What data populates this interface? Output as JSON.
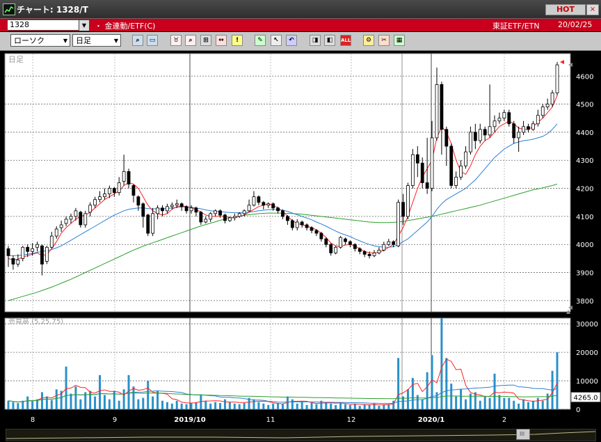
{
  "window": {
    "title": "チャート: 1328/T",
    "hot_label": "HOT",
    "close_glyph": "×"
  },
  "info": {
    "code": "1328",
    "name": "・ 金連動/ETF(C)",
    "market": "東証ETF/ETN",
    "date": "20/02/25"
  },
  "toolbar": {
    "chart_type": "ローソク",
    "period": "日足",
    "buttons": [
      "zoom-icon",
      "window-icon",
      "bull-icon",
      "search-date-icon",
      "grid-icon",
      "crosshair-icon",
      "alert-icon",
      "draw-icon",
      "cursor-icon",
      "undo-icon",
      "zoom-out-icon",
      "zoom-in-icon",
      "all-icon",
      "settings-icon",
      "tools-icon",
      "color-icon"
    ],
    "all_label": "ALL"
  },
  "price_panel": {
    "label": "日足",
    "ticks": [
      "4600",
      "4500",
      "4400",
      "4300",
      "4200",
      "4100",
      "4000",
      "3900",
      "3800"
    ]
  },
  "volume_panel": {
    "label": "売買高 (5,25,75)",
    "ticks": [
      "30000",
      "20000",
      "10000",
      "0"
    ],
    "last_value": "4265.0"
  },
  "x_axis": {
    "labels": [
      "8",
      "9",
      "2019/10",
      "11",
      "12",
      "2020/1",
      "2"
    ]
  },
  "colors": {
    "up": "#ffffff",
    "down": "#000000",
    "ma_short": "#ff2020",
    "ma_mid": "#2a7fd6",
    "ma_long": "#2aa02a",
    "volume": "#2a90c8",
    "grid": "#666666",
    "marker": "#ff2020"
  },
  "chart_data": {
    "type": "candlestick",
    "x_labels": [
      "8",
      "9",
      "2019/10",
      "11",
      "12",
      "2020/1",
      "2"
    ],
    "price_ylim": [
      3760,
      4680
    ],
    "volume_ylim": [
      0,
      32000
    ],
    "price_ticks": [
      4600,
      4500,
      4400,
      4300,
      4200,
      4100,
      4000,
      3900,
      3800
    ],
    "volume_ticks": [
      30000,
      20000,
      10000,
      0
    ],
    "candles": [
      [
        3985,
        3960,
        3995,
        3920
      ],
      [
        3950,
        3930,
        3960,
        3910
      ],
      [
        3930,
        3945,
        3965,
        3920
      ],
      [
        3950,
        3990,
        3995,
        3940
      ],
      [
        3990,
        3975,
        4000,
        3955
      ],
      [
        3975,
        3985,
        4005,
        3960
      ],
      [
        3990,
        4000,
        4010,
        3975
      ],
      [
        3995,
        3930,
        4000,
        3890
      ],
      [
        3940,
        3990,
        3995,
        3930
      ],
      [
        3990,
        4030,
        4045,
        3985
      ],
      [
        4030,
        4055,
        4065,
        4020
      ],
      [
        4060,
        4070,
        4085,
        4045
      ],
      [
        4075,
        4090,
        4100,
        4065
      ],
      [
        4090,
        4100,
        4110,
        4075
      ],
      [
        4100,
        4120,
        4130,
        4085
      ],
      [
        4115,
        4070,
        4120,
        4060
      ],
      [
        4070,
        4110,
        4120,
        4060
      ],
      [
        4115,
        4140,
        4150,
        4100
      ],
      [
        4140,
        4160,
        4170,
        4130
      ],
      [
        4160,
        4170,
        4190,
        4150
      ],
      [
        4170,
        4180,
        4200,
        4160
      ],
      [
        4180,
        4200,
        4210,
        4165
      ],
      [
        4200,
        4185,
        4205,
        4170
      ],
      [
        4185,
        4220,
        4240,
        4175
      ],
      [
        4225,
        4260,
        4320,
        4210
      ],
      [
        4260,
        4215,
        4270,
        4200
      ],
      [
        4210,
        4175,
        4215,
        4150
      ],
      [
        4170,
        4140,
        4175,
        4120
      ],
      [
        4145,
        4100,
        4150,
        4060
      ],
      [
        4105,
        4040,
        4110,
        4030
      ],
      [
        4040,
        4110,
        4130,
        4030
      ],
      [
        4110,
        4130,
        4140,
        4090
      ],
      [
        4130,
        4120,
        4140,
        4100
      ],
      [
        4120,
        4135,
        4145,
        4110
      ],
      [
        4135,
        4140,
        4150,
        4125
      ],
      [
        4140,
        4145,
        4160,
        4130
      ],
      [
        4145,
        4135,
        4150,
        4120
      ],
      [
        4135,
        4120,
        4140,
        4110
      ],
      [
        4120,
        4130,
        4140,
        4110
      ],
      [
        4130,
        4115,
        4135,
        4100
      ],
      [
        4115,
        4080,
        4120,
        4070
      ],
      [
        4080,
        4090,
        4100,
        4075
      ],
      [
        4090,
        4110,
        4115,
        4080
      ],
      [
        4110,
        4120,
        4125,
        4100
      ],
      [
        4120,
        4105,
        4125,
        4095
      ],
      [
        4105,
        4085,
        4110,
        4075
      ],
      [
        4085,
        4095,
        4100,
        4080
      ],
      [
        4095,
        4100,
        4110,
        4085
      ],
      [
        4100,
        4110,
        4115,
        4095
      ],
      [
        4110,
        4120,
        4125,
        4100
      ],
      [
        4120,
        4140,
        4160,
        4115
      ],
      [
        4140,
        4170,
        4190,
        4135
      ],
      [
        4170,
        4150,
        4175,
        4140
      ],
      [
        4150,
        4140,
        4155,
        4125
      ],
      [
        4140,
        4145,
        4150,
        4130
      ],
      [
        4145,
        4130,
        4150,
        4120
      ],
      [
        4130,
        4120,
        4135,
        4110
      ],
      [
        4120,
        4100,
        4125,
        4090
      ],
      [
        4100,
        4085,
        4105,
        4070
      ],
      [
        4085,
        4060,
        4090,
        4050
      ],
      [
        4060,
        4080,
        4090,
        4050
      ],
      [
        4080,
        4070,
        4085,
        4060
      ],
      [
        4070,
        4060,
        4075,
        4050
      ],
      [
        4060,
        4050,
        4065,
        4040
      ],
      [
        4050,
        4040,
        4055,
        4030
      ],
      [
        4040,
        4020,
        4045,
        4010
      ],
      [
        4020,
        4000,
        4025,
        3990
      ],
      [
        4000,
        3970,
        4005,
        3960
      ],
      [
        3970,
        3990,
        3995,
        3965
      ],
      [
        3990,
        4025,
        4030,
        3985
      ],
      [
        4020,
        4010,
        4025,
        4000
      ],
      [
        4010,
        4000,
        4015,
        3990
      ],
      [
        4000,
        3985,
        4005,
        3975
      ],
      [
        3985,
        3975,
        3990,
        3965
      ],
      [
        3975,
        3965,
        3980,
        3955
      ],
      [
        3965,
        3960,
        3975,
        3950
      ],
      [
        3960,
        3970,
        3980,
        3955
      ],
      [
        3970,
        3980,
        3990,
        3965
      ],
      [
        3980,
        4000,
        4010,
        3975
      ],
      [
        4000,
        4010,
        4020,
        3995
      ],
      [
        4010,
        4000,
        4015,
        3990
      ],
      [
        3995,
        4150,
        4160,
        3990
      ],
      [
        4150,
        4100,
        4180,
        4070
      ],
      [
        4100,
        4210,
        4220,
        4090
      ],
      [
        4210,
        4320,
        4340,
        4200
      ],
      [
        4320,
        4290,
        4350,
        4240
      ],
      [
        4290,
        4220,
        4310,
        4200
      ],
      [
        4220,
        4200,
        4380,
        4180
      ],
      [
        4200,
        4380,
        4440,
        4190
      ],
      [
        4380,
        4570,
        4630,
        4370
      ],
      [
        4570,
        4410,
        4580,
        4320
      ],
      [
        4410,
        4350,
        4420,
        4280
      ],
      [
        4350,
        4210,
        4360,
        4200
      ],
      [
        4210,
        4240,
        4260,
        4200
      ],
      [
        4240,
        4280,
        4300,
        4230
      ],
      [
        4280,
        4330,
        4350,
        4270
      ],
      [
        4330,
        4400,
        4420,
        4320
      ],
      [
        4400,
        4370,
        4430,
        4340
      ],
      [
        4370,
        4410,
        4430,
        4360
      ],
      [
        4410,
        4390,
        4420,
        4370
      ],
      [
        4390,
        4420,
        4570,
        4380
      ],
      [
        4420,
        4440,
        4460,
        4400
      ],
      [
        4440,
        4450,
        4470,
        4430
      ],
      [
        4450,
        4470,
        4480,
        4440
      ],
      [
        4470,
        4430,
        4480,
        4420
      ],
      [
        4430,
        4380,
        4440,
        4360
      ],
      [
        4380,
        4400,
        4420,
        4330
      ],
      [
        4400,
        4420,
        4440,
        4390
      ],
      [
        4420,
        4410,
        4430,
        4400
      ],
      [
        4410,
        4430,
        4440,
        4405
      ],
      [
        4430,
        4460,
        4480,
        4420
      ],
      [
        4460,
        4490,
        4500,
        4450
      ],
      [
        4490,
        4500,
        4520,
        4480
      ],
      [
        4500,
        4540,
        4550,
        4490
      ],
      [
        4540,
        4640,
        4650,
        4530
      ]
    ],
    "volumes": [
      3000,
      2500,
      2200,
      3000,
      4500,
      2800,
      3500,
      6000,
      4500,
      3200,
      7000,
      6500,
      15000,
      5500,
      8000,
      3500,
      6000,
      6500,
      4500,
      12000,
      5000,
      3500,
      6500,
      3000,
      7000,
      12000,
      8000,
      3500,
      4000,
      10000,
      4500,
      6500,
      3000,
      2500,
      2000,
      3000,
      2000,
      1800,
      2200,
      2500,
      5000,
      3000,
      2000,
      2500,
      2200,
      3500,
      2500,
      2000,
      1800,
      2200,
      4000,
      3500,
      2500,
      2000,
      1500,
      2000,
      2200,
      1800,
      4500,
      3500,
      2000,
      2500,
      1500,
      2200,
      1800,
      3000,
      2500,
      2000,
      1500,
      2200,
      1800,
      1500,
      2000,
      1200,
      1800,
      1500,
      2000,
      1200,
      1500,
      1800,
      3000,
      18000,
      4500,
      7000,
      11000,
      5000,
      3500,
      13000,
      19000,
      6000,
      32000,
      18000,
      9000,
      4500,
      7000,
      3500,
      5500,
      6000,
      3000,
      4500,
      4000,
      12500,
      5000,
      4000,
      4000,
      3000,
      2000,
      3500,
      2500,
      3000,
      4000,
      3000,
      5500,
      13500,
      20000
    ],
    "ma_short": [
      3950,
      3945,
      3948,
      3955,
      3960,
      3965,
      3970,
      3960,
      3965,
      3985,
      4010,
      4040,
      4060,
      4075,
      4090,
      4100,
      4105,
      4115,
      4130,
      4145,
      4160,
      4170,
      4180,
      4190,
      4210,
      4220,
      4215,
      4200,
      4170,
      4140,
      4120,
      4110,
      4105,
      4110,
      4125,
      4135,
      4138,
      4135,
      4130,
      4125,
      4115,
      4105,
      4100,
      4100,
      4102,
      4100,
      4095,
      4095,
      4100,
      4105,
      4115,
      4125,
      4135,
      4140,
      4145,
      4140,
      4130,
      4118,
      4100,
      4085,
      4075,
      4070,
      4065,
      4060,
      4052,
      4040,
      4025,
      4005,
      3995,
      3992,
      3998,
      4000,
      3995,
      3985,
      3975,
      3970,
      3970,
      3972,
      3980,
      3990,
      4000,
      4030,
      4060,
      4100,
      4150,
      4200,
      4240,
      4270,
      4300,
      4380,
      4420,
      4400,
      4360,
      4300,
      4260,
      4250,
      4280,
      4320,
      4350,
      4370,
      4380,
      4400,
      4420,
      4430,
      4440,
      4430,
      4415,
      4410,
      4410,
      4420,
      4435,
      4450,
      4470,
      4490,
      4530
    ],
    "ma_mid": [
      3960,
      3960,
      3960,
      3962,
      3965,
      3968,
      3972,
      3975,
      3978,
      3982,
      3988,
      3995,
      4005,
      4015,
      4025,
      4035,
      4045,
      4055,
      4065,
      4075,
      4085,
      4095,
      4105,
      4112,
      4120,
      4125,
      4128,
      4130,
      4130,
      4128,
      4127,
      4127,
      4127,
      4128,
      4130,
      4132,
      4134,
      4134,
      4133,
      4130,
      4127,
      4123,
      4120,
      4118,
      4117,
      4115,
      4114,
      4113,
      4113,
      4113,
      4115,
      4117,
      4120,
      4122,
      4124,
      4125,
      4124,
      4122,
      4118,
      4112,
      4106,
      4100,
      4094,
      4088,
      4080,
      4073,
      4065,
      4056,
      4048,
      4040,
      4034,
      4028,
      4020,
      4013,
      4006,
      4000,
      3995,
      3992,
      3990,
      3990,
      3992,
      4000,
      4010,
      4020,
      4035,
      4050,
      4065,
      4080,
      4100,
      4125,
      4145,
      4160,
      4170,
      4180,
      4190,
      4200,
      4215,
      4230,
      4250,
      4270,
      4290,
      4310,
      4325,
      4340,
      4350,
      4360,
      4365,
      4370,
      4372,
      4375,
      4380,
      4385,
      4395,
      4410,
      4430
    ],
    "ma_long": [
      3800,
      3805,
      3810,
      3815,
      3820,
      3825,
      3830,
      3836,
      3842,
      3848,
      3855,
      3862,
      3869,
      3876,
      3884,
      3892,
      3900,
      3908,
      3916,
      3924,
      3932,
      3940,
      3948,
      3956,
      3964,
      3972,
      3980,
      3987,
      3994,
      4000,
      4006,
      4012,
      4018,
      4024,
      4030,
      4036,
      4042,
      4048,
      4054,
      4060,
      4066,
      4071,
      4076,
      4081,
      4086,
      4090,
      4094,
      4098,
      4101,
      4104,
      4106,
      4108,
      4110,
      4111,
      4112,
      4112,
      4112,
      4112,
      4111,
      4110,
      4109,
      4108,
      4106,
      4104,
      4102,
      4100,
      4098,
      4096,
      4094,
      4092,
      4090,
      4088,
      4086,
      4084,
      4082,
      4080,
      4079,
      4078,
      4078,
      4078,
      4079,
      4080,
      4082,
      4085,
      4088,
      4091,
      4094,
      4097,
      4100,
      4104,
      4108,
      4112,
      4116,
      4120,
      4124,
      4128,
      4132,
      4136,
      4140,
      4145,
      4150,
      4155,
      4160,
      4165,
      4170,
      4175,
      4180,
      4185,
      4190,
      4195,
      4198,
      4202,
      4206,
      4210,
      4215
    ]
  }
}
